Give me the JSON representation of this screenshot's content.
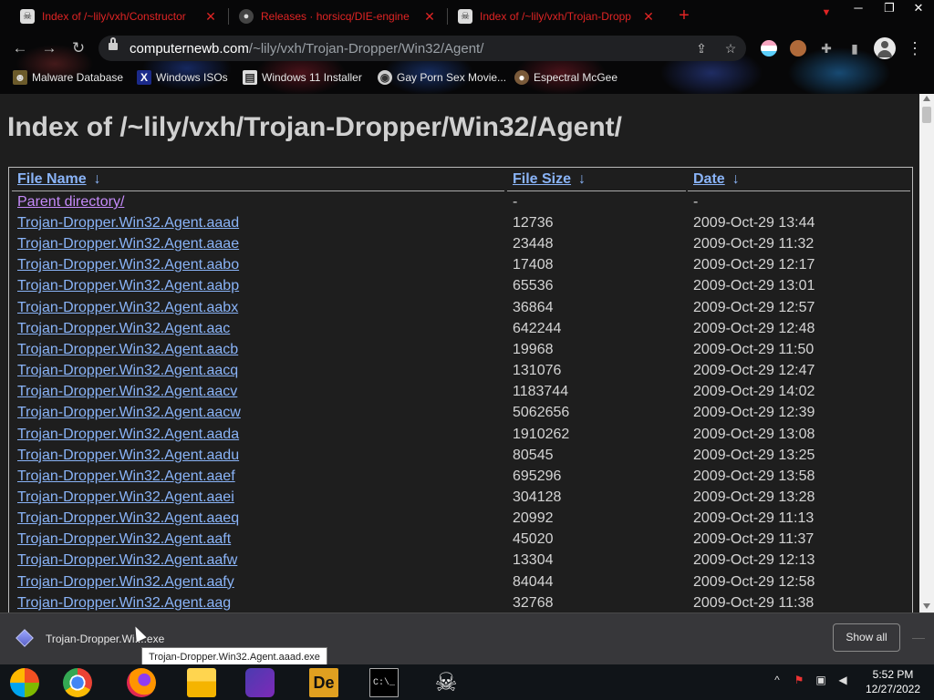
{
  "browser": {
    "tabs": [
      {
        "title": "Index of /~lily/vxh/Constructor",
        "active": false
      },
      {
        "title": "Releases · horsicq/DIE-engine",
        "active": false
      },
      {
        "title": "Index of /~lily/vxh/Trojan-Dropp",
        "active": true
      }
    ],
    "new_tab": "+",
    "url": {
      "host": "computernewb.com",
      "path": "/~lily/vxh/Trojan-Dropper/Win32/Agent/"
    },
    "bookmarks": [
      "Malware Database",
      "Windows ISOs",
      "Windows 11 Installer",
      "Gay Porn Sex Movie...",
      "Espectral McGee"
    ],
    "accent_color": "#e02424"
  },
  "page": {
    "title": "Index of /~lily/vxh/Trojan-Dropper/Win32/Agent/",
    "columns": {
      "name": "File Name",
      "size": "File Size",
      "date": "Date",
      "sort_arrow": "↓"
    },
    "parent": {
      "name": "Parent directory/",
      "size": "-",
      "date": "-"
    },
    "files": [
      {
        "name": "Trojan-Dropper.Win32.Agent.aaad",
        "size": "12736",
        "date": "2009-Oct-29 13:44"
      },
      {
        "name": "Trojan-Dropper.Win32.Agent.aaae",
        "size": "23448",
        "date": "2009-Oct-29 11:32"
      },
      {
        "name": "Trojan-Dropper.Win32.Agent.aabo",
        "size": "17408",
        "date": "2009-Oct-29 12:17"
      },
      {
        "name": "Trojan-Dropper.Win32.Agent.aabp",
        "size": "65536",
        "date": "2009-Oct-29 13:01"
      },
      {
        "name": "Trojan-Dropper.Win32.Agent.aabx",
        "size": "36864",
        "date": "2009-Oct-29 12:57"
      },
      {
        "name": "Trojan-Dropper.Win32.Agent.aac",
        "size": "642244",
        "date": "2009-Oct-29 12:48"
      },
      {
        "name": "Trojan-Dropper.Win32.Agent.aacb",
        "size": "19968",
        "date": "2009-Oct-29 11:50"
      },
      {
        "name": "Trojan-Dropper.Win32.Agent.aacq",
        "size": "131076",
        "date": "2009-Oct-29 12:47"
      },
      {
        "name": "Trojan-Dropper.Win32.Agent.aacv",
        "size": "1183744",
        "date": "2009-Oct-29 14:02"
      },
      {
        "name": "Trojan-Dropper.Win32.Agent.aacw",
        "size": "5062656",
        "date": "2009-Oct-29 12:39"
      },
      {
        "name": "Trojan-Dropper.Win32.Agent.aada",
        "size": "1910262",
        "date": "2009-Oct-29 13:08"
      },
      {
        "name": "Trojan-Dropper.Win32.Agent.aadu",
        "size": "80545",
        "date": "2009-Oct-29 13:25"
      },
      {
        "name": "Trojan-Dropper.Win32.Agent.aaef",
        "size": "695296",
        "date": "2009-Oct-29 13:58"
      },
      {
        "name": "Trojan-Dropper.Win32.Agent.aaei",
        "size": "304128",
        "date": "2009-Oct-29 13:28"
      },
      {
        "name": "Trojan-Dropper.Win32.Agent.aaeq",
        "size": "20992",
        "date": "2009-Oct-29 11:13"
      },
      {
        "name": "Trojan-Dropper.Win32.Agent.aaft",
        "size": "45020",
        "date": "2009-Oct-29 11:37"
      },
      {
        "name": "Trojan-Dropper.Win32.Agent.aafw",
        "size": "13304",
        "date": "2009-Oct-29 12:13"
      },
      {
        "name": "Trojan-Dropper.Win32.Agent.aafy",
        "size": "84044",
        "date": "2009-Oct-29 12:58"
      },
      {
        "name": "Trojan-Dropper.Win32.Agent.aag",
        "size": "32768",
        "date": "2009-Oct-29 11:38"
      }
    ],
    "link_color": "#8ab4f8",
    "visited_color": "#c58af9"
  },
  "download_shelf": {
    "file_label": "Trojan-Dropper.Wi....exe",
    "tooltip": "Trojan-Dropper.Win32.Agent.aaad.exe",
    "show_all": "Show all"
  },
  "taskbar": {
    "apps": [
      "start-icon",
      "chrome-icon",
      "firefox-icon",
      "file-explorer-icon",
      "people-icon",
      "die-engine-icon",
      "command-prompt-icon",
      "skull-icon"
    ],
    "die_label": "De",
    "cmd_label": "C:\\_",
    "time": "5:52 PM",
    "date": "12/27/2022"
  }
}
